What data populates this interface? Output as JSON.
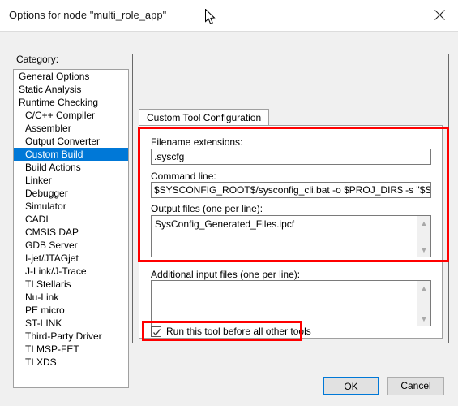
{
  "window": {
    "title": "Options for node \"multi_role_app\"",
    "close_icon": "close-icon"
  },
  "sidebar": {
    "label": "Category:",
    "items": [
      {
        "label": "General Options",
        "indent": false,
        "selected": false
      },
      {
        "label": "Static Analysis",
        "indent": false,
        "selected": false
      },
      {
        "label": "Runtime Checking",
        "indent": false,
        "selected": false
      },
      {
        "label": "C/C++ Compiler",
        "indent": true,
        "selected": false
      },
      {
        "label": "Assembler",
        "indent": true,
        "selected": false
      },
      {
        "label": "Output Converter",
        "indent": true,
        "selected": false
      },
      {
        "label": "Custom Build",
        "indent": true,
        "selected": true
      },
      {
        "label": "Build Actions",
        "indent": true,
        "selected": false
      },
      {
        "label": "Linker",
        "indent": true,
        "selected": false
      },
      {
        "label": "Debugger",
        "indent": true,
        "selected": false
      },
      {
        "label": "Simulator",
        "indent": true,
        "selected": false,
        "extra": true
      },
      {
        "label": "CADI",
        "indent": true,
        "selected": false,
        "extra": true
      },
      {
        "label": "CMSIS DAP",
        "indent": true,
        "selected": false,
        "extra": true
      },
      {
        "label": "GDB Server",
        "indent": true,
        "selected": false,
        "extra": true
      },
      {
        "label": "I-jet/JTAGjet",
        "indent": true,
        "selected": false,
        "extra": true
      },
      {
        "label": "J-Link/J-Trace",
        "indent": true,
        "selected": false,
        "extra": true
      },
      {
        "label": "TI Stellaris",
        "indent": true,
        "selected": false,
        "extra": true
      },
      {
        "label": "Nu-Link",
        "indent": true,
        "selected": false,
        "extra": true
      },
      {
        "label": "PE micro",
        "indent": true,
        "selected": false,
        "extra": true
      },
      {
        "label": "ST-LINK",
        "indent": true,
        "selected": false,
        "extra": true
      },
      {
        "label": "Third-Party Driver",
        "indent": true,
        "selected": false,
        "extra": true
      },
      {
        "label": "TI MSP-FET",
        "indent": true,
        "selected": false,
        "extra": true
      },
      {
        "label": "TI XDS",
        "indent": true,
        "selected": false,
        "extra": true
      }
    ]
  },
  "tabs": [
    {
      "label": "Custom Tool Configuration",
      "active": true
    }
  ],
  "form": {
    "filename_extensions": {
      "label": "Filename extensions:",
      "value": ".syscfg"
    },
    "command_line": {
      "label": "Command line:",
      "value": "$SYSCONFIG_ROOT$/sysconfig_cli.bat -o $PROJ_DIR$ -s \"$SIMPLELIN"
    },
    "output_files": {
      "label": "Output files (one per line):",
      "value": "SysConfig_Generated_Files.ipcf"
    },
    "additional_input_files": {
      "label": "Additional input files (one per line):",
      "value": ""
    },
    "run_before": {
      "label": "Run this tool before all other tools",
      "checked": true
    }
  },
  "footer": {
    "ok_label": "OK",
    "cancel_label": "Cancel"
  },
  "colors": {
    "selection_blue": "#0078d7",
    "annotation_red": "#ff0000",
    "window_bg": "#f0f0f0"
  }
}
